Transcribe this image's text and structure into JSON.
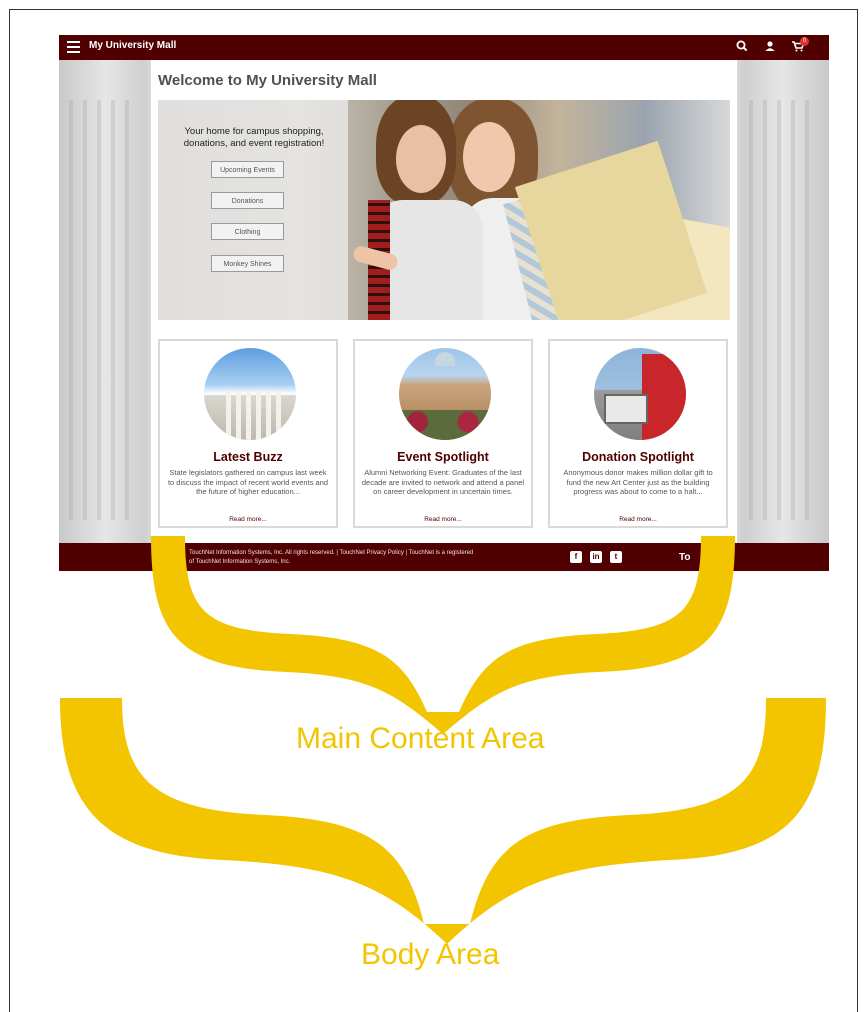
{
  "app": {
    "brand": "My University Mall",
    "cart_count": "0"
  },
  "main": {
    "title": "Welcome to My University Mall",
    "hero": {
      "tagline": "Your home for campus shopping, donations, and event registration!",
      "buttons": [
        "Upcoming Events",
        "Donations",
        "Clothing",
        "Monkey Shines"
      ]
    },
    "cards": [
      {
        "title": "Latest Buzz",
        "text": "State legislators gathered on campus last week to discuss the impact of recent world events and the future of higher education...",
        "link": "Read more..."
      },
      {
        "title": "Event Spotlight",
        "text": "Alumni Networking Event: Graduates of the last decade are invited to network and attend a panel on career development in uncertain times.",
        "link": "Read more..."
      },
      {
        "title": "Donation Spotlight",
        "text": "Anonymous donor makes million dollar gift to fund the new Art Center just as the building progress was about to come to a halt...",
        "link": "Read more..."
      }
    ]
  },
  "footer": {
    "line1": "TouchNet Information Systems, Inc. All rights reserved. | TouchNet Privacy Policy | TouchNet is a registered",
    "line2": "of TouchNet Information Systems, Inc.",
    "brand": "To",
    "social": [
      "f",
      "in",
      "t"
    ]
  },
  "annotations": {
    "main_content": "Main Content Area",
    "body": "Body Area"
  },
  "colors": {
    "maroon": "#500000",
    "annotation_yellow": "#f2c500"
  },
  "icons": [
    "menu-icon",
    "search-icon",
    "user-icon",
    "cart-icon",
    "facebook-icon",
    "linkedin-icon",
    "twitter-icon"
  ]
}
